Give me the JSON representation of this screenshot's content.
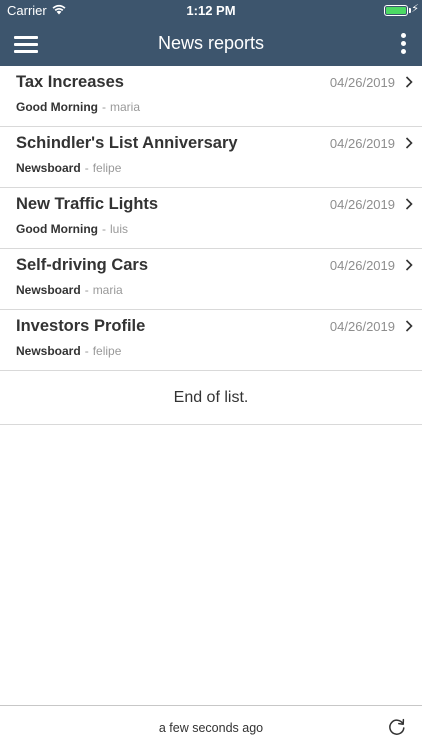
{
  "status_bar": {
    "carrier": "Carrier",
    "time": "1:12 PM",
    "battery_color": "#4cd964"
  },
  "nav": {
    "title": "News reports",
    "menu_icon": "hamburger-menu-icon",
    "more_icon": "more-vertical-icon",
    "bar_color": "#3d556d"
  },
  "reports": [
    {
      "title": "Tax Increases",
      "date": "04/26/2019",
      "source": "Good Morning",
      "separator": "-",
      "author": "maria"
    },
    {
      "title": "Schindler's List Anniversary",
      "date": "04/26/2019",
      "source": "Newsboard",
      "separator": "-",
      "author": "felipe"
    },
    {
      "title": "New Traffic Lights",
      "date": "04/26/2019",
      "source": "Good Morning",
      "separator": "-",
      "author": "luis"
    },
    {
      "title": "Self-driving Cars",
      "date": "04/26/2019",
      "source": "Newsboard",
      "separator": "-",
      "author": "maria"
    },
    {
      "title": "Investors Profile",
      "date": "04/26/2019",
      "source": "Newsboard",
      "separator": "-",
      "author": "felipe"
    }
  ],
  "end_of_list": "End of list.",
  "footer": {
    "last_updated": "a few seconds ago",
    "refresh_icon": "refresh-icon"
  }
}
